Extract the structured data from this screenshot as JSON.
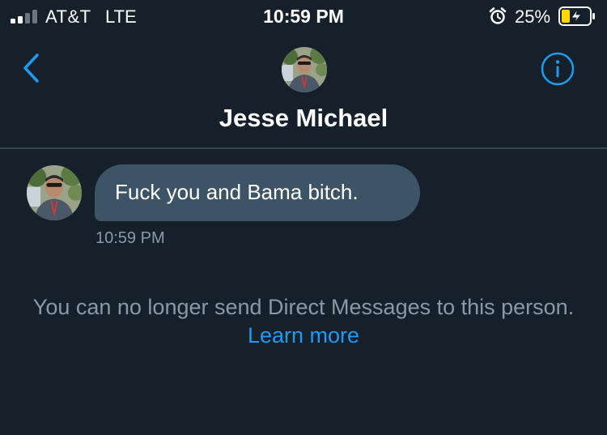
{
  "status_bar": {
    "carrier": "AT&T",
    "network": "LTE",
    "time": "10:59 PM",
    "battery_percent": "25%",
    "signal_icon": "signal-bars-icon",
    "alarm_icon": "alarm-clock-icon",
    "battery_icon": "battery-charging-icon"
  },
  "header": {
    "contact_name": "Jesse Michael",
    "back_icon": "chevron-left-icon",
    "info_icon": "info-icon"
  },
  "conversation": {
    "messages": [
      {
        "text": "Fuck you and Bama bitch.",
        "time": "10:59 PM"
      }
    ]
  },
  "notice": {
    "text": "You can no longer send Direct Messages to this person.",
    "link": "Learn more"
  },
  "colors": {
    "background": "#15202b",
    "bubble": "#3d5466",
    "accent": "#1d9bf0",
    "muted_text": "#8b98a5"
  }
}
